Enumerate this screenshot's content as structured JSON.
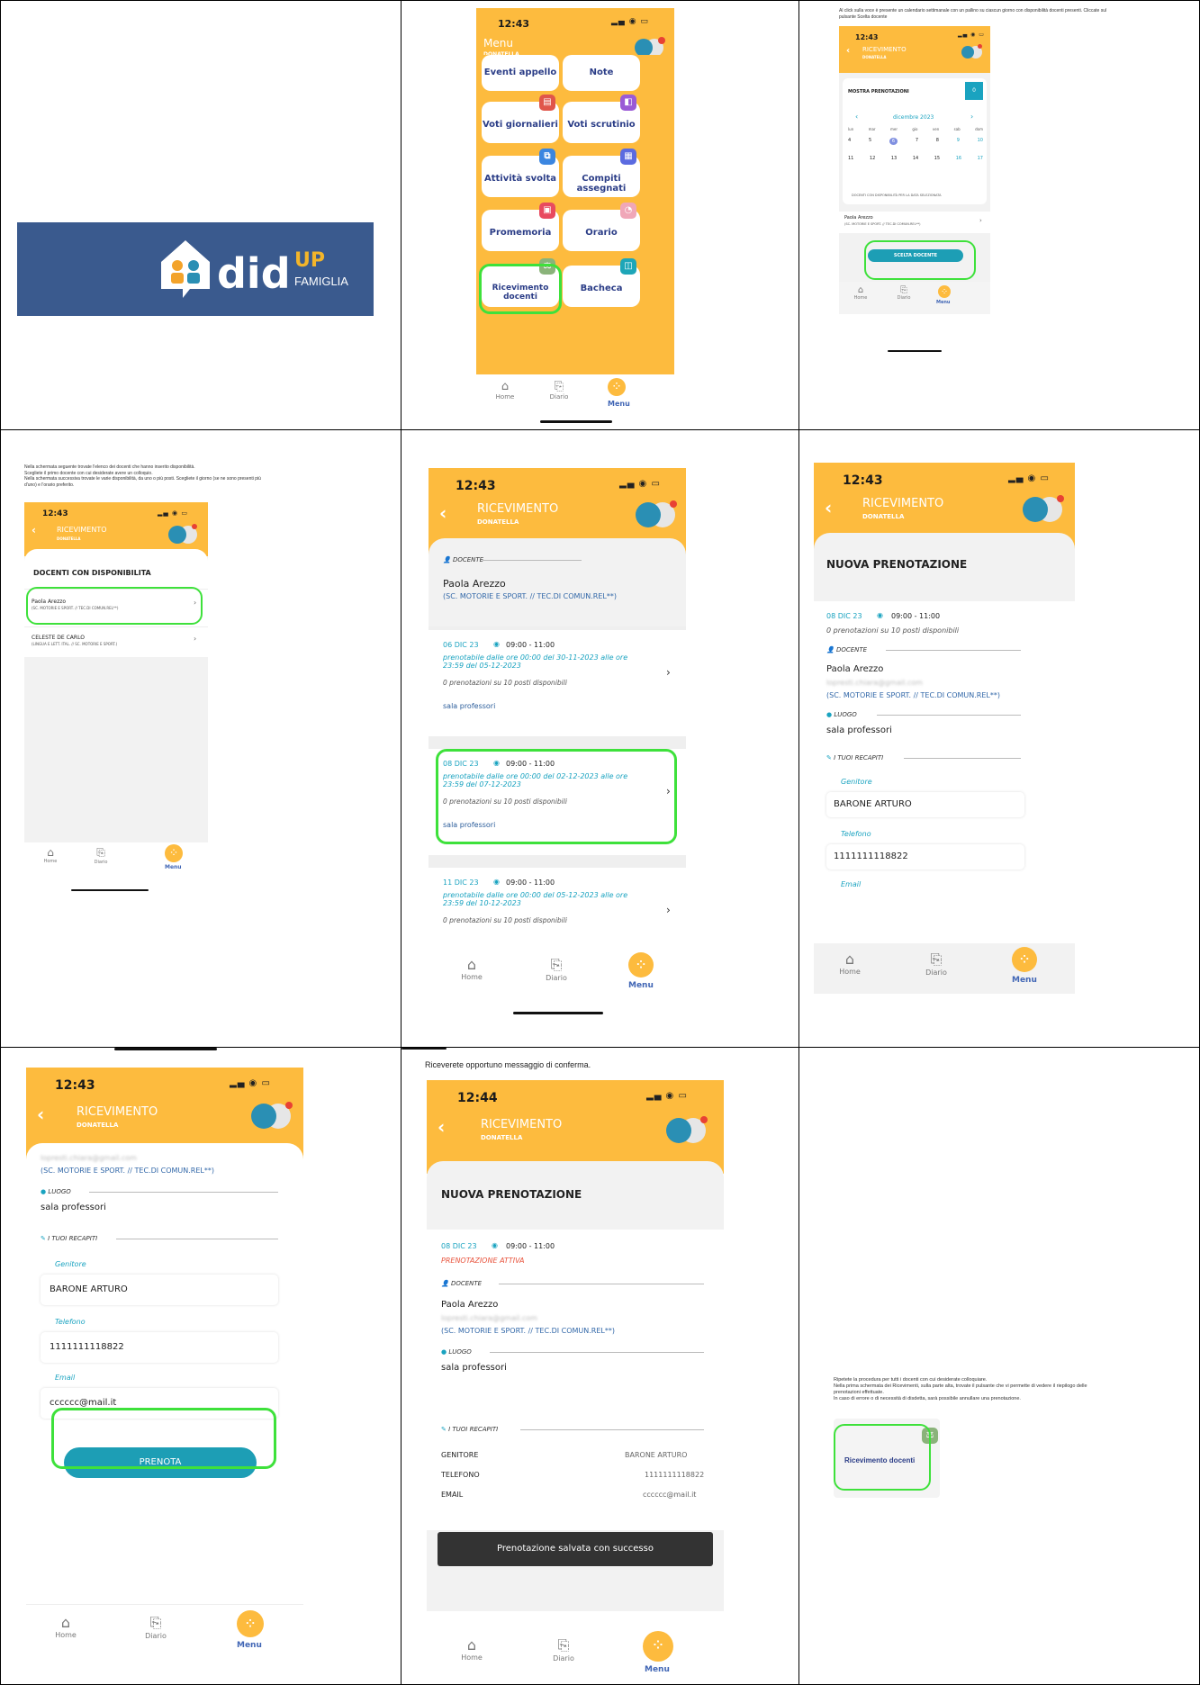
{
  "brand": {
    "did": "did",
    "up": "UP",
    "famiglia": "FAMIGLIA",
    "bg": "#3a5a8e"
  },
  "clock": "12:43",
  "clock_b": "12:44",
  "colors": {
    "yellow": "#FDBB3E",
    "teal": "#1aa3c0",
    "green": "#3ee13b"
  },
  "phone_menu": {
    "title": "Menu",
    "subtitle": "DONATELLA",
    "tiles": [
      "Eventi appello",
      "Note",
      "Voti giornalieri",
      "Voti scrutinio",
      "Attività svolta",
      "Compiti assegnati",
      "Promemoria",
      "Orario",
      "Ricevimento docenti",
      "Bacheca"
    ]
  },
  "nav": {
    "home": "Home",
    "diario": "Diario",
    "menu": "Menu"
  },
  "ric": {
    "title": "RICEVIMENTO",
    "subtitle": "DONATELLA"
  },
  "cell3": {
    "intro": "Al click sulla voce è presente un calendario settimanale con un pallino su ciascun giorno con disponibilità docenti presenti. Cliccate sul pulsante Scelta docente",
    "show_label": "MOSTRA PRENOTAZIONI",
    "show_count": "0",
    "month": "dicembre 2023",
    "weekdays": [
      "lun",
      "mar",
      "mer",
      "gio",
      "ven",
      "sab",
      "dom"
    ],
    "week1": [
      "4",
      "5",
      "6",
      "7",
      "8",
      "9",
      "10"
    ],
    "week2": [
      "11",
      "12",
      "13",
      "14",
      "15",
      "16",
      "17"
    ],
    "avail": "DOCENTI CON DISPONIBILITÀ PER LA DATA SELEZIONATA",
    "teacher": "Paola Arezzo",
    "teacher_sub": "(SC. MOTORIE E SPORT. // TEC.DI COMUN.REL**)",
    "btn": "SCELTA DOCENTE"
  },
  "cell4": {
    "intro1": "Nella schermata seguente trovate l'elenco dei docenti che hanno inserito disponibilità.",
    "intro2": "Scegliete il primo docente con cui desiderate avere un colloquio.",
    "intro3": "Nella schermata successiva trovate le varie disponibilità, da uno o più posti. Scegliete il giorno (se ne sono presenti più",
    "intro4": "d'uno) e l'orario preferito.",
    "heading": "DOCENTI CON DISPONIBILITA",
    "t1": "Paola Arezzo",
    "t1s": "(SC. MOTORIE E SPORT. // TEC.DI COMUN.REL**)",
    "t2": "CELESTE DE CARLO",
    "t2s": "(LINGUA E LETT. ITAL. // SC. MOTORIE E SPORT.)"
  },
  "cell5": {
    "docente": "DOCENTE",
    "name": "Paola Arezzo",
    "sub": "(SC. MOTORIE E SPORT. // TEC.DI COMUN.REL**)",
    "slots": [
      {
        "date": "06 DIC 23",
        "time": "09:00 - 11:00",
        "pren": "prenotabile dalle ore 00:00 del 30-11-2023 alle ore 23:59 del 05-12-2023",
        "posti": "0 prenotazioni su 10 posti disponibili",
        "luogo": "sala professori"
      },
      {
        "date": "08 DIC 23",
        "time": "09:00 - 11:00",
        "pren": "prenotabile dalle ore 00:00 del 02-12-2023 alle ore 23:59 del 07-12-2023",
        "posti": "0 prenotazioni su 10 posti disponibili",
        "luogo": "sala professori"
      },
      {
        "date": "11 DIC 23",
        "time": "09:00 - 11:00",
        "pren": "prenotabile dalle ore 00:00 del 05-12-2023 alle ore 23:59 del 10-12-2023",
        "posti": "0 prenotazioni su 10 posti disponibili",
        "luogo": ""
      }
    ]
  },
  "cell6": {
    "heading": "NUOVA PRENOTAZIONE",
    "date": "08 DIC 23",
    "time": "09:00 - 11:00",
    "posti": "0 prenotazioni su 10 posti disponibili",
    "docente": "DOCENTE",
    "name": "Paola Arezzo",
    "email": "lopresti.chiara@gmail.com",
    "sub": "(SC. MOTORIE E SPORT. // TEC.DI COMUN.REL**)",
    "luogo_l": "LUOGO",
    "luogo": "sala professori",
    "recapiti": "I TUOI RECAPITI",
    "gen_l": "Genitore",
    "gen": "BARONE ARTURO",
    "tel_l": "Telefono",
    "tel": "1111111118822",
    "email_l": "Email"
  },
  "cell7": {
    "email": "lopresti.chiara@gmail.com",
    "sub": "(SC. MOTORIE E SPORT. // TEC.DI COMUN.REL**)",
    "luogo_l": "LUOGO",
    "luogo": "sala professori",
    "recapiti": "I TUOI RECAPITI",
    "gen_l": "Genitore",
    "gen": "BARONE ARTURO",
    "tel_l": "Telefono",
    "tel": "1111111118822",
    "email_l": "Email",
    "email_v": "cccccc@mail.it",
    "btn": "PRENOTA"
  },
  "cell8": {
    "intro": "Riceverete opportuno messaggio di conferma.",
    "heading": "NUOVA PRENOTAZIONE",
    "date": "08 DIC 23",
    "time": "09:00 - 11:00",
    "status": "PRENOTAZIONE ATTIVA",
    "docente": "DOCENTE",
    "name": "Paola Arezzo",
    "email": "lopresti.chiara@gmail.com",
    "sub": "(SC. MOTORIE E SPORT. // TEC.DI COMUN.REL**)",
    "luogo_l": "LUOGO",
    "luogo": "sala professori",
    "recapiti": "I TUOI RECAPITI",
    "gen_l": "GENITORE",
    "gen": "BARONE ARTURO",
    "tel_l": "TELEFONO",
    "tel": "1111111118822",
    "em_l": "EMAIL",
    "em": "cccccc@mail.it",
    "toast": "Prenotazione salvata con successo"
  },
  "cell9": {
    "l1": "Ripetete la procedura per tutti i docenti con cui desiderate colloquiare.",
    "l2": "Nella prima schermata dei Ricevimenti, sulla parte alta, trovate il pulsante che vi permette di vedere il riepilogo delle",
    "l3": "prenotazioni effettuate.",
    "l4": "In caso di errore o di necessità di disdetta, sarà possibile annullare una prenotazione.",
    "tile": "Ricevimento docenti"
  }
}
